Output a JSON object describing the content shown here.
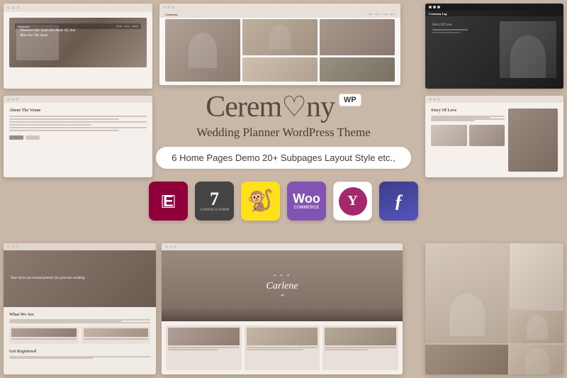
{
  "theme": {
    "name": "Ceremony",
    "tagline": "Wedding Planner WordPress Theme",
    "features_badge": "6 Home Pages Demo  20+ Subpages Layout Style etc.,",
    "logo_text_part1": "Cerem",
    "logo_text_part2": "ny",
    "heart_char": "♥",
    "wp_badge": "WP",
    "background_color": "#c9b8a8"
  },
  "plugins": [
    {
      "id": "elementor",
      "label": "E",
      "name": "Elementor"
    },
    {
      "id": "cf7",
      "label": "7",
      "sublabel": "CONTACT FORM",
      "name": "Contact Form 7"
    },
    {
      "id": "mailchimp",
      "label": "🐒",
      "name": "Mailchimp"
    },
    {
      "id": "woo",
      "label": "Woo",
      "name": "WooCommerce"
    },
    {
      "id": "yoast",
      "label": "Y",
      "name": "Yoast SEO"
    },
    {
      "id": "fontawesome",
      "label": "F",
      "name": "Font Awesome"
    }
  ],
  "screenshots": {
    "top_left_quote": "Whatever Our Souls Are Made Of, And Mine Are The Same",
    "bot_left_hero": "Your all in one trusted planner for glorious wedding",
    "bot_left_title": "What We Are",
    "bot_left_cta": "Get Registered",
    "bot_center_brand": "Carlene",
    "mid_right_title": "Story Of Love"
  }
}
